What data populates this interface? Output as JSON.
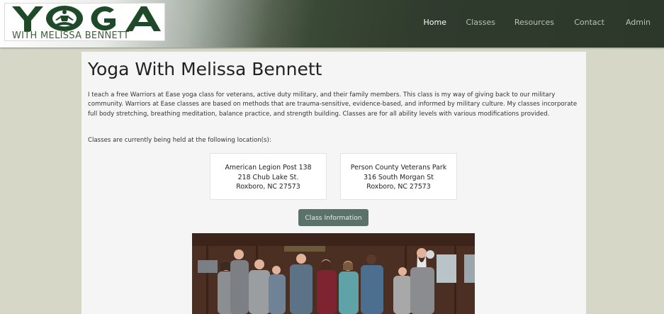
{
  "header": {
    "logo_word": "YOGA",
    "logo_tagline": "WITH MELISSA BENNETT",
    "nav": [
      {
        "label": "Home",
        "active": true
      },
      {
        "label": "Classes",
        "active": false
      },
      {
        "label": "Resources",
        "active": false
      },
      {
        "label": "Contact",
        "active": false
      },
      {
        "label": "Admin",
        "active": false
      }
    ]
  },
  "main": {
    "title": "Yoga With Melissa Bennett",
    "intro": "I teach a free Warriors at Ease yoga class for veterans, active duty military, and their family members. This class is my way of giving back to our military community. Warriors at Ease classes are based on methods that are trauma-sensitive, evidence-based, and informed by military culture. My classes incorporate full body stretching, breathing meditation, balance practice, and strength building. Classes are for all ability levels with various modifications provided.",
    "locations_label": "Classes are currently being held at the following location(s):",
    "locations": [
      {
        "name": "American Legion Post 138",
        "street": "218 Chub Lake St.",
        "city": "Roxboro, NC 27573"
      },
      {
        "name": "Person County Veterans Park",
        "street": "316 South Morgan St",
        "city": "Roxboro, NC 27573"
      }
    ],
    "class_info_button": "Class Information"
  },
  "colors": {
    "page_background": "#d6d7c6",
    "header_dark": "#2c382a",
    "logo_green": "#1f4a2a",
    "button": "#5a7269"
  }
}
